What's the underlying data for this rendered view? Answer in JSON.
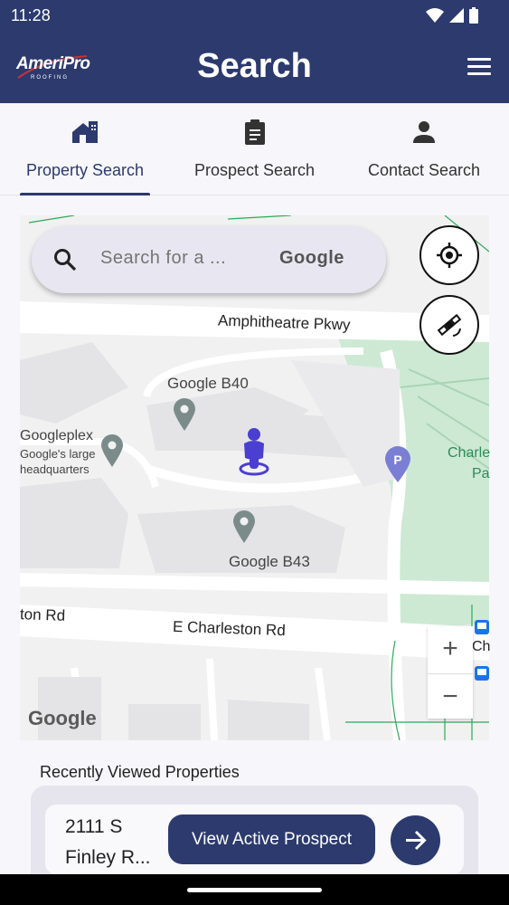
{
  "status_bar": {
    "time": "11:28"
  },
  "header": {
    "logo_text": "AmeriPro",
    "logo_subtext": "ROOFING",
    "title": "Search"
  },
  "tabs": [
    {
      "label": "Property Search",
      "icon": "house-icon",
      "active": true
    },
    {
      "label": "Prospect Search",
      "icon": "clipboard-icon",
      "active": false
    },
    {
      "label": "Contact Search",
      "icon": "person-icon",
      "active": false
    }
  ],
  "map": {
    "search": {
      "placeholder": "Search for a ...",
      "provider_label": "Google"
    },
    "labels": {
      "road1": "Amphitheatre Pkwy",
      "b40": "Google B40",
      "googleplex": "Googleplex",
      "googleplex_sub1": "Google's large",
      "googleplex_sub2": "headquarters",
      "b43": "Google B43",
      "road2": "E Charleston Rd",
      "road2_left": "ton Rd",
      "park1": "Charle",
      "park2": "Pa",
      "right_cut": "Ch",
      "watermark": "Google"
    },
    "zoom_in": "+",
    "zoom_out": "−"
  },
  "recent": {
    "section_label": "Recently Viewed Properties",
    "items": [
      {
        "address_line1": "2111 S",
        "address_line2": "Finley R...",
        "action_label": "View Active Prospect"
      }
    ]
  },
  "colors": {
    "primary": "#2c3a6e",
    "pin": "#4a3fd1",
    "park": "#cde9d4"
  }
}
